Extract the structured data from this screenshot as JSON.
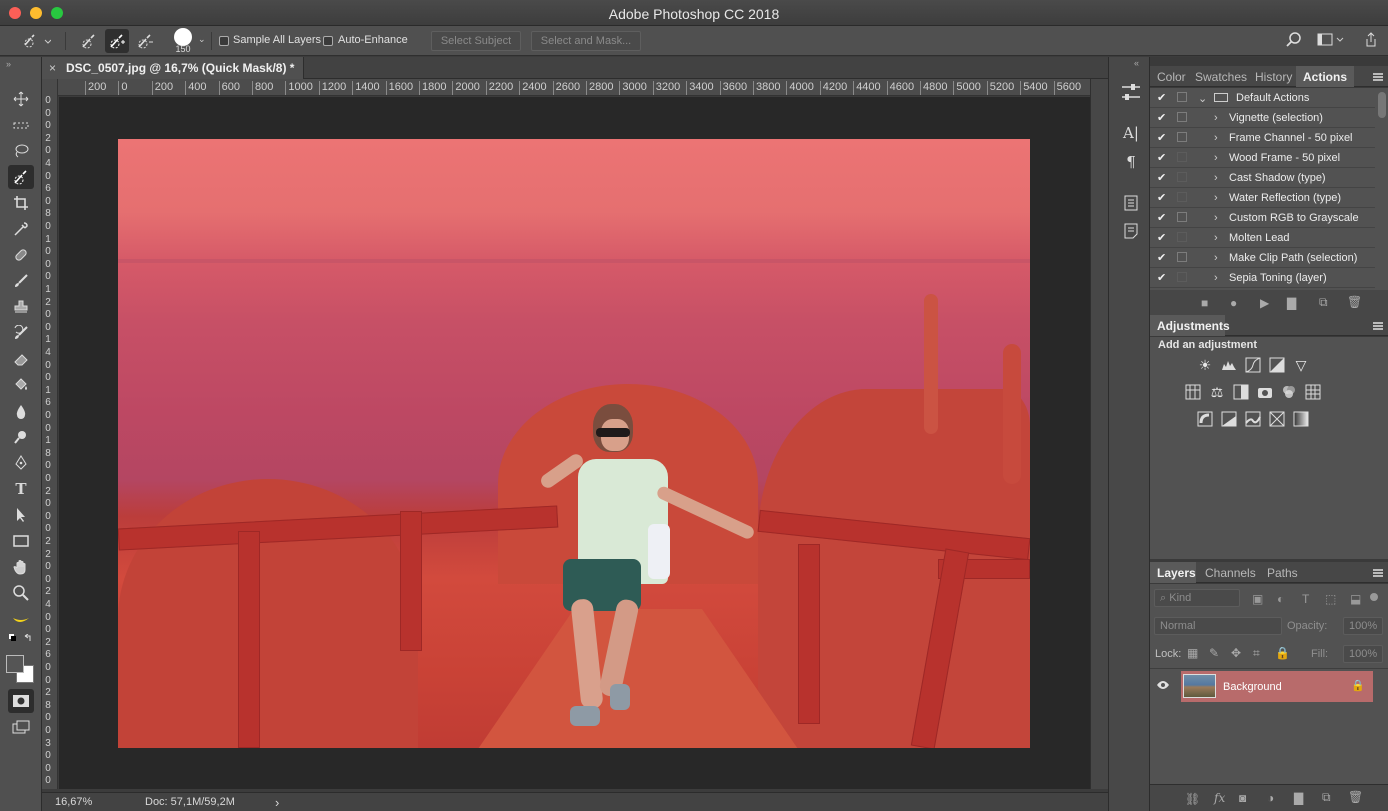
{
  "app": {
    "title": "Adobe Photoshop CC 2018"
  },
  "options_bar": {
    "brush_size": "150",
    "sample_all_layers": "Sample All Layers",
    "auto_enhance": "Auto-Enhance",
    "select_subject": "Select Subject",
    "select_and_mask": "Select and Mask..."
  },
  "document": {
    "tab_title": "DSC_0507.jpg @ 16,7% (Quick Mask/8) *",
    "close_glyph": "×"
  },
  "rulers": {
    "top": [
      "200",
      "0",
      "200",
      "400",
      "600",
      "800",
      "1000",
      "1200",
      "1400",
      "1600",
      "1800",
      "2000",
      "2200",
      "2400",
      "2600",
      "2800",
      "3000",
      "3200",
      "3400",
      "3600",
      "3800",
      "4000",
      "4200",
      "4400",
      "4600",
      "4800",
      "5000",
      "5200",
      "5400",
      "5600"
    ],
    "left": [
      "0",
      "0",
      "0",
      "2",
      "0",
      "4",
      "0",
      "6",
      "0",
      "8",
      "0",
      "1",
      "0",
      "0",
      "0",
      "1",
      "2",
      "0",
      "0",
      "1",
      "4",
      "0",
      "0",
      "1",
      "6",
      "0",
      "0",
      "1",
      "8",
      "0",
      "0",
      "2",
      "0",
      "0",
      "0",
      "2",
      "2",
      "0",
      "0",
      "2",
      "4",
      "0",
      "0",
      "2",
      "6",
      "0",
      "0",
      "2",
      "8",
      "0",
      "0",
      "3",
      "0",
      "0",
      "0"
    ]
  },
  "status": {
    "zoom": "16,67%",
    "doc": "Doc: 57,1M/59,2M",
    "arrow": "›"
  },
  "panels": {
    "top_tabs": [
      "Color",
      "Swatches",
      "History",
      "Actions"
    ],
    "actions": {
      "set_name": "Default Actions",
      "items": [
        "Vignette (selection)",
        "Frame Channel - 50 pixel",
        "Wood Frame - 50 pixel",
        "Cast Shadow (type)",
        "Water Reflection (type)",
        "Custom RGB to Grayscale",
        "Molten Lead",
        "Make Clip Path (selection)",
        "Sepia Toning (layer)"
      ]
    },
    "adjustments": {
      "tab": "Adjustments",
      "heading": "Add an adjustment"
    },
    "layers": {
      "tabs": [
        "Layers",
        "Channels",
        "Paths"
      ],
      "kind_placeholder": "Kind",
      "blend_mode": "Normal",
      "opacity_label": "Opacity:",
      "opacity_value": "100%",
      "lock_label": "Lock:",
      "fill_label": "Fill:",
      "fill_value": "100%",
      "layer_name": "Background"
    }
  },
  "colors": {
    "accent_layer": "#b86b6b",
    "mask_red": "#e56f70",
    "chrome": "#505050"
  }
}
